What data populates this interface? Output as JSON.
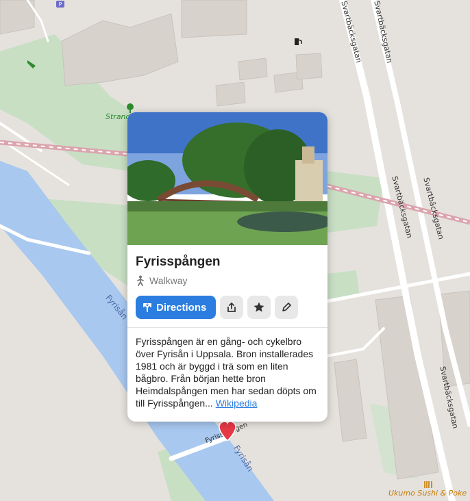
{
  "popup": {
    "title": "Fyrisspången",
    "category": "Walkway",
    "directions_label": "Directions",
    "description": "Fyrisspången är en gång- och cykelbro över Fyrisån i Uppsala. Bron installerades 1981 och är byggd i trä som en liten bågbro. Från början hette bron Heimdalspången men har sedan döpts om till Fyrisspången...",
    "wikipedia_label": "Wikipedia",
    "icons": {
      "category": "pedestrian-icon",
      "directions": "directions-icon",
      "share": "share-icon",
      "favorite": "star-icon",
      "edit": "pencil-icon"
    }
  },
  "map": {
    "streets": [
      "Svartbäcksgatan",
      "Svartbäcksgatan",
      "Svartbäcksgatan",
      "Svartbäcksgatan",
      "Svartbäcksgatan"
    ],
    "water_labels": [
      "Fyrisån",
      "Fyrisån"
    ],
    "bridge_label": "Fyrisspången",
    "poi": {
      "park_partial": "Strand",
      "restaurant": "Ukumo Sushi & Poke"
    },
    "parking_symbol": "P",
    "colors": {
      "land": "#e5e2dd",
      "green": "#c8dfc4",
      "water": "#a8c8ef",
      "building": "#d7d2cc",
      "railway": "#dba5ae",
      "accent": "#2b7de0",
      "pin": "#e63946",
      "poi_restaurant": "#c77a00",
      "poi_park": "#2e8b2e"
    }
  }
}
